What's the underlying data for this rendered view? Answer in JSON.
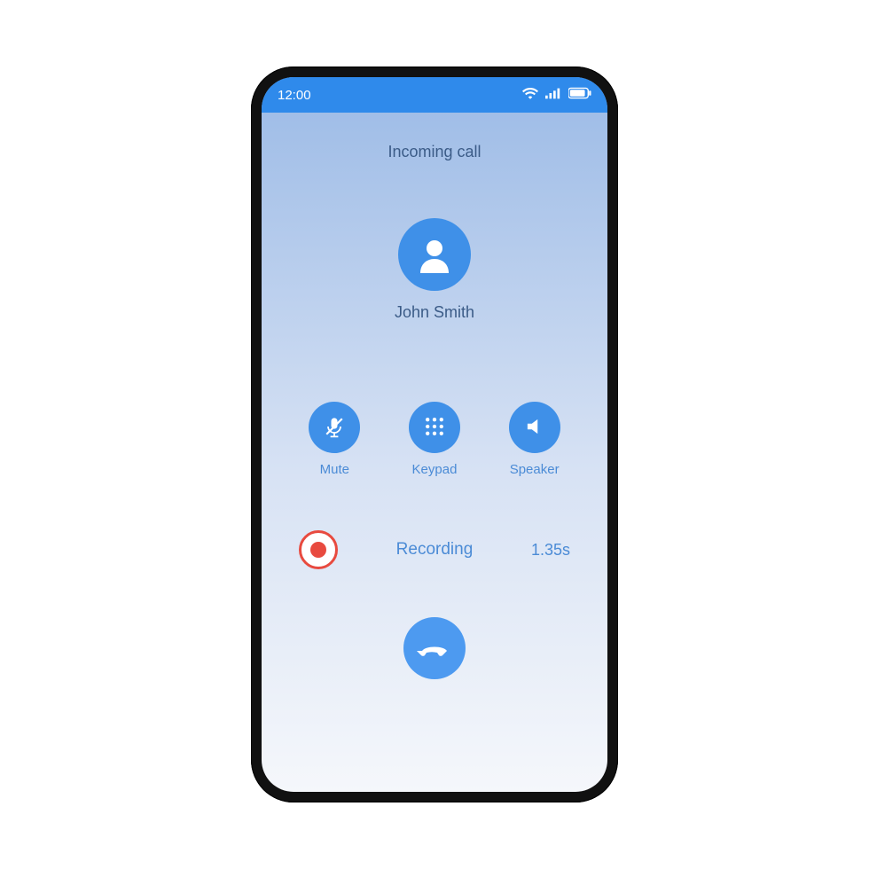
{
  "statusBar": {
    "time": "12:00"
  },
  "call": {
    "title": "Incoming call",
    "callerName": "John Smith"
  },
  "controls": {
    "mute": "Mute",
    "keypad": "Keypad",
    "speaker": "Speaker"
  },
  "recording": {
    "label": "Recording",
    "time": "1.35s"
  },
  "colors": {
    "accent": "#3f90e8",
    "statusBar": "#2f8aeb",
    "textMuted": "#3b5b87",
    "link": "#4b8bd6",
    "record": "#e84a3f"
  }
}
